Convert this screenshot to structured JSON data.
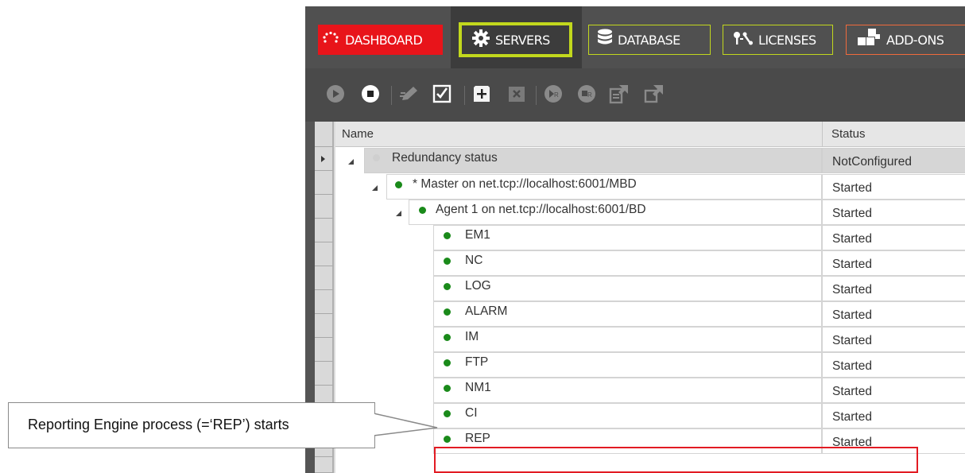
{
  "nav": {
    "tabs": [
      {
        "label": "DASHBOARD",
        "icon": "dashboard-spinner-icon",
        "color": "#e8141a"
      },
      {
        "label": "SERVERS",
        "icon": "gear-icon",
        "selected": true,
        "color": "#c2d81d"
      },
      {
        "label": "DATABASE",
        "icon": "database-icon",
        "color": "#c2d81d"
      },
      {
        "label": "LICENSES",
        "icon": "key-wrench-icon",
        "color": "#c2d81d"
      },
      {
        "label": "ADD-ONS",
        "icon": "puzzle-blocks-icon",
        "color": "#f06a3c"
      }
    ]
  },
  "toolbar": {
    "buttons": [
      "play-icon",
      "stop-icon",
      "edit-icon",
      "checkbox-icon",
      "add-icon",
      "remove-icon",
      "play-r-icon",
      "stop-r-icon",
      "export-icon",
      "import-icon"
    ]
  },
  "grid": {
    "columns": {
      "name": "Name",
      "status": "Status"
    },
    "rows": [
      {
        "name": "Redundancy status",
        "status": "NotConfigured",
        "level": 0
      },
      {
        "name": "* Master on net.tcp://localhost:6001/MBD",
        "status": "Started",
        "level": 1
      },
      {
        "name": "Agent 1 on net.tcp://localhost:6001/BD",
        "status": "Started",
        "level": 2
      },
      {
        "name": "EM1",
        "status": "Started",
        "level": 3
      },
      {
        "name": "NC",
        "status": "Started",
        "level": 3
      },
      {
        "name": "LOG",
        "status": "Started",
        "level": 3
      },
      {
        "name": "ALARM",
        "status": "Started",
        "level": 3
      },
      {
        "name": "IM",
        "status": "Started",
        "level": 3
      },
      {
        "name": "FTP",
        "status": "Started",
        "level": 3
      },
      {
        "name": "NM1",
        "status": "Started",
        "level": 3
      },
      {
        "name": "CI",
        "status": "Started",
        "level": 3
      },
      {
        "name": "REP",
        "status": "Started",
        "level": 3
      }
    ],
    "status_color": "#1a8a1a"
  },
  "callout": {
    "text": "Reporting Engine process (=‘REP’) starts",
    "highlight_color": "#e21b23"
  }
}
